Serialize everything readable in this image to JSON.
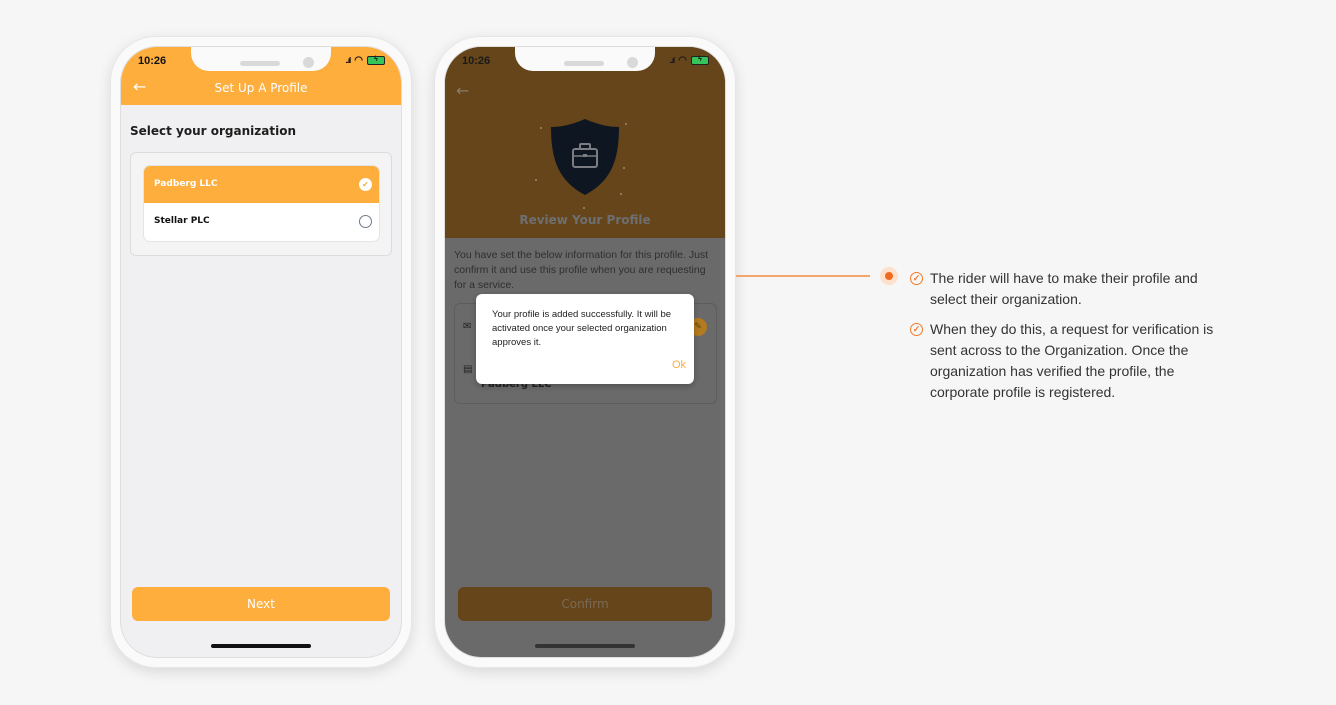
{
  "phone1": {
    "status": {
      "time": "10:26",
      "signal": "....",
      "wifi": "wifi-icon",
      "battery": "charging"
    },
    "header": {
      "back_icon": "←",
      "title": "Set Up A Profile"
    },
    "section_label": "Select your organization",
    "organizations": [
      {
        "name": "Padberg LLC",
        "selected": true,
        "check": "✔"
      },
      {
        "name": "Stellar PLC",
        "selected": false,
        "check": ""
      }
    ],
    "next_label": "Next"
  },
  "phone2": {
    "status": {
      "time": "10:26",
      "signal": "....",
      "wifi": "wifi-icon",
      "battery": "charging"
    },
    "back_icon": "←",
    "title": "Review Your Profile",
    "info_text": "You have set the below information for this profile. Just confirm it and use this profile when you are requesting for a service.",
    "card": {
      "mail_icon": "✉",
      "building_icon": "▤",
      "edit_icon": "✎",
      "organization": "Padberg LLC"
    },
    "dialog": {
      "message": "Your profile is added successfully. It will be activated once your selected organization approves it.",
      "ok_label": "Ok"
    },
    "confirm_label": "Confirm"
  },
  "annotation": {
    "notes": [
      "The rider will have to make their profile and select their organization.",
      "When they do this, a request for verification is sent across to the Organization. Once the organization has verified the profile, the corporate profile is registered."
    ],
    "check_icon": "✓"
  },
  "colors": {
    "accent": "#fdae3d",
    "annotation_accent": "#f26b1d",
    "overlay_header": "#654519"
  }
}
